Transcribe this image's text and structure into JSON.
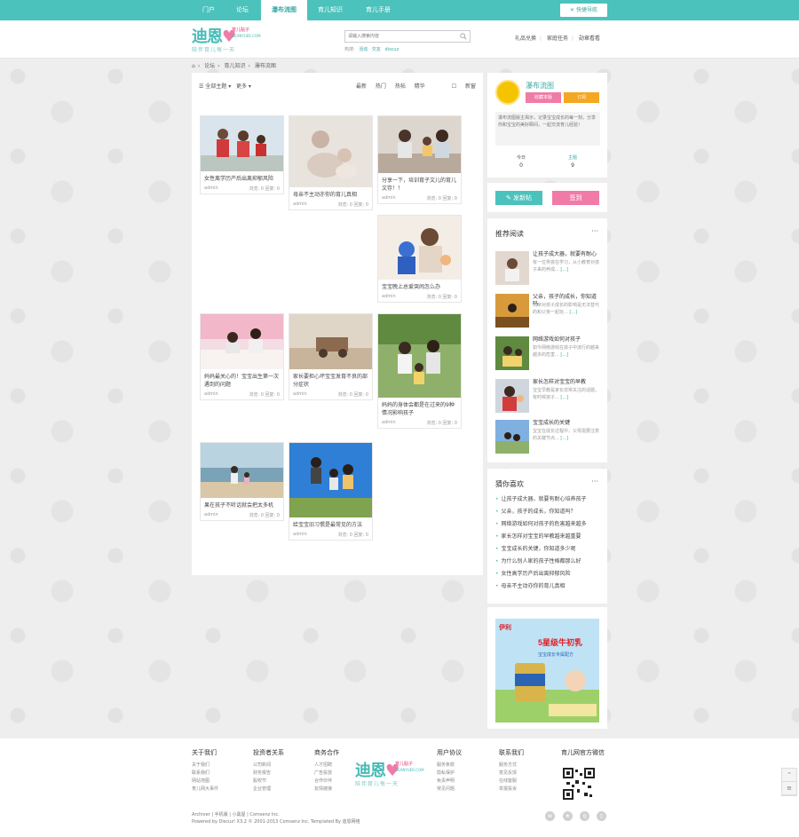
{
  "topnav": {
    "items": [
      "门户",
      "论坛",
      "瀑布流图",
      "育儿知识",
      "育儿手册"
    ],
    "active_index": 2,
    "quick_nav": "快捷导航"
  },
  "logo": {
    "main": "迪恩",
    "tag": "育儿贴子",
    "url": "DEANYUER.COM",
    "slogan": "陪伴育儿每一天"
  },
  "search": {
    "placeholder": "请输入搜索内容",
    "hot_label": "热搜:",
    "hot_keywords": [
      "活动",
      "交友",
      "discuz"
    ]
  },
  "header_links": [
    "礼品兑换",
    "家庭任务",
    "勋章看看"
  ],
  "breadcrumb": [
    "论坛",
    "育儿知识",
    "瀑布流图"
  ],
  "toolbar": {
    "filter_all": "全部主题",
    "more": "更多",
    "sort": [
      "最新",
      "热门",
      "热帖",
      "精华"
    ],
    "view": "新窗"
  },
  "cards": [
    {
      "title": "女性离学历产后出离抑郁风险",
      "author": "admin",
      "views": "浏览: 0",
      "replies": "回复: 0"
    },
    {
      "title": "母亲不主动亦你的育儿真相",
      "author": "admin",
      "views": "浏览: 0",
      "replies": "回复: 0"
    },
    {
      "title": "分享一下，培训育子文儿的育儿文存！！",
      "author": "admin",
      "views": "浏览: 0",
      "replies": "回复: 0"
    },
    {
      "title": "宝宝晚上总爱哭闹怎么办",
      "author": "admin",
      "views": "浏览: 0",
      "replies": "回复: 0"
    },
    {
      "title": "妈妈最关心的！宝宝出生第一次遇到的问题",
      "author": "admin",
      "views": "浏览: 0",
      "replies": "回复: 0"
    },
    {
      "title": "家长要担心坏宝宝发育不良的部分症状",
      "author": "admin",
      "views": "浏览: 0",
      "replies": "回复: 0"
    },
    {
      "title": "妈妈的身体会都是在过来的9种情况影响孩子",
      "author": "admin",
      "views": "浏览: 0",
      "replies": "回复: 0"
    },
    {
      "title": "果在孩子不听话就会把太多机",
      "author": "admin",
      "views": "浏览: 0",
      "replies": "回复: 0"
    },
    {
      "title": "给宝宝旧习惯是最常见的方法",
      "author": "admin",
      "views": "浏览: 0",
      "replies": "回复: 0"
    }
  ],
  "forum": {
    "name": "瀑布流图",
    "favorite_btn": "收藏本版",
    "subscribe_btn": "订阅",
    "description": "瀑布流图版主揭示，记录宝宝成长的每一刻，分享你和宝宝的美好瞬间，一起交流育儿经验！",
    "today_label": "今日",
    "today_value": "0",
    "topics_label": "主题",
    "topics_value": "9"
  },
  "actions": {
    "post": "发新帖",
    "sign": "签到"
  },
  "recommend": {
    "title": "推荐阅读",
    "more": "···",
    "items": [
      {
        "title": "让孩子成大器，就要有耐心",
        "desc": "有一位男孩在学习，从小教育对孩子来的养成...",
        "more": "[...]"
      },
      {
        "title": "父亲，孩子的成长，你知道吗",
        "desc": "父亲对孩子成长的影响是无法替代的和父亲一起玩...",
        "more": "[...]"
      },
      {
        "title": "网络游戏如何对孩子",
        "desc": "如今网络游戏在孩子中流行的越来越多的危害...",
        "more": "[...]"
      },
      {
        "title": "家长怎样对宝宝的早教",
        "desc": "宝宝早教是家长非常关注的话题，有时候孩子...",
        "more": "[...]"
      },
      {
        "title": "宝宝成长的关键",
        "desc": "宝宝在成长过程中，父母需要注意的关键节点...",
        "more": "[...]"
      }
    ]
  },
  "guess": {
    "title": "猜你喜欢",
    "more": "···",
    "items": [
      "让孩子成大器，就要有耐心培养孩子",
      "父亲，孩子的成长，你知道吗？",
      "网络游戏如何对孩子的危害越来越多",
      "家长怎样对宝宝的早教越来越重要",
      "宝宝成长的关键，你知道多少呢",
      "为什么别人家的孩子性格都那么好",
      "女性高学历产后出离抑郁风险",
      "母亲不主动亦你的育儿真相"
    ]
  },
  "ad": {
    "brand": "伊利",
    "headline": "5星级牛初乳",
    "sub": "宝宝成长专属配方"
  },
  "footer": {
    "columns": [
      {
        "title": "关于我们",
        "links": [
          "关于我们",
          "联系我们",
          "网站地图",
          "育儿网大事件"
        ]
      },
      {
        "title": "投资者关系",
        "links": [
          "公司新闻",
          "财务报告",
          "股权节",
          "企业管理"
        ]
      },
      {
        "title": "商务合作",
        "links": [
          "人才招聘",
          "广告投放",
          "合作伙伴",
          "友情链接"
        ]
      },
      {
        "title": "用户协议",
        "links": [
          "服务条款",
          "隐私保护",
          "免责声明",
          "常见问题"
        ]
      },
      {
        "title": "联系我们",
        "links": [
          "服务方式",
          "意见反馈",
          "在线客服",
          "举报投诉"
        ]
      },
      {
        "title": "育儿网官方微信",
        "links": []
      }
    ],
    "copyright_line1": "Archiver | 手机版 | 小黑屋 | Comsenz Inc.",
    "copyright_line2": "Powered by Discuz! X3.2 © 2001-2013 Comsenz Inc. Templated By 迪恩网络",
    "social_icons": [
      "weibo-icon",
      "star-icon",
      "qq-icon",
      "phone-icon"
    ]
  },
  "side_tools": [
    "top",
    "list"
  ]
}
